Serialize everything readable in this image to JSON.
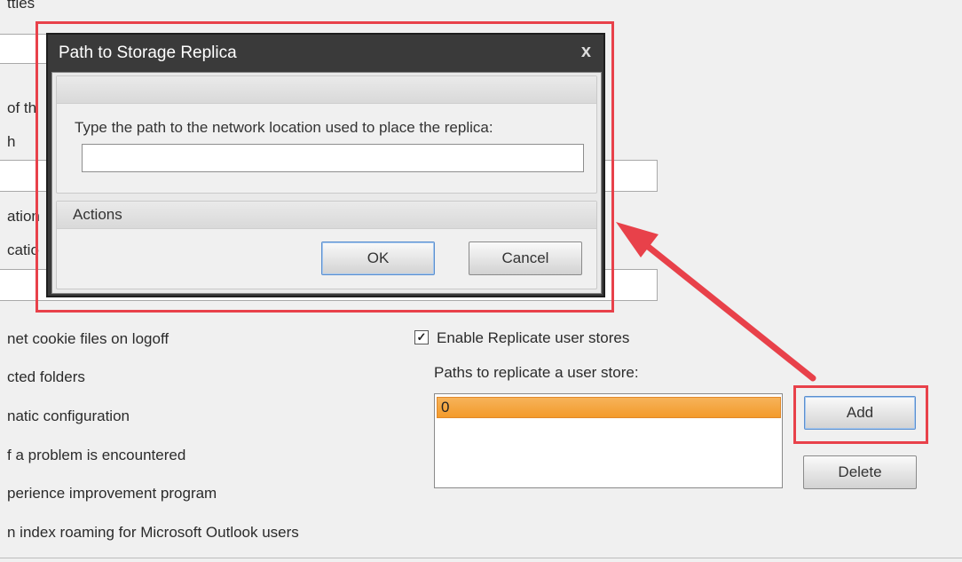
{
  "background": {
    "fragments": [
      "tties",
      "of th",
      "h",
      "ation",
      "catio"
    ],
    "options": [
      "net cookie files on logoff",
      "cted folders",
      "natic configuration",
      "f a problem is encountered",
      "perience improvement program",
      "n index roaming for Microsoft Outlook users"
    ]
  },
  "dialog": {
    "title": "Path to Storage Replica",
    "close_glyph": "x",
    "path_label": "Type the path to the network location used to place the replica:",
    "path_value": "",
    "actions_header": "Actions",
    "ok_label": "OK",
    "cancel_label": "Cancel"
  },
  "replicate": {
    "checkbox_label": "Enable Replicate user stores",
    "checked": true,
    "check_glyph": "✓",
    "paths_label": "Paths to replicate a user store:",
    "paths": [
      "0"
    ],
    "add_label": "Add",
    "delete_label": "Delete"
  },
  "colors": {
    "highlight": "#e8414a",
    "selection": "#f39a2a",
    "dialog_frame": "#3a3a3a"
  }
}
